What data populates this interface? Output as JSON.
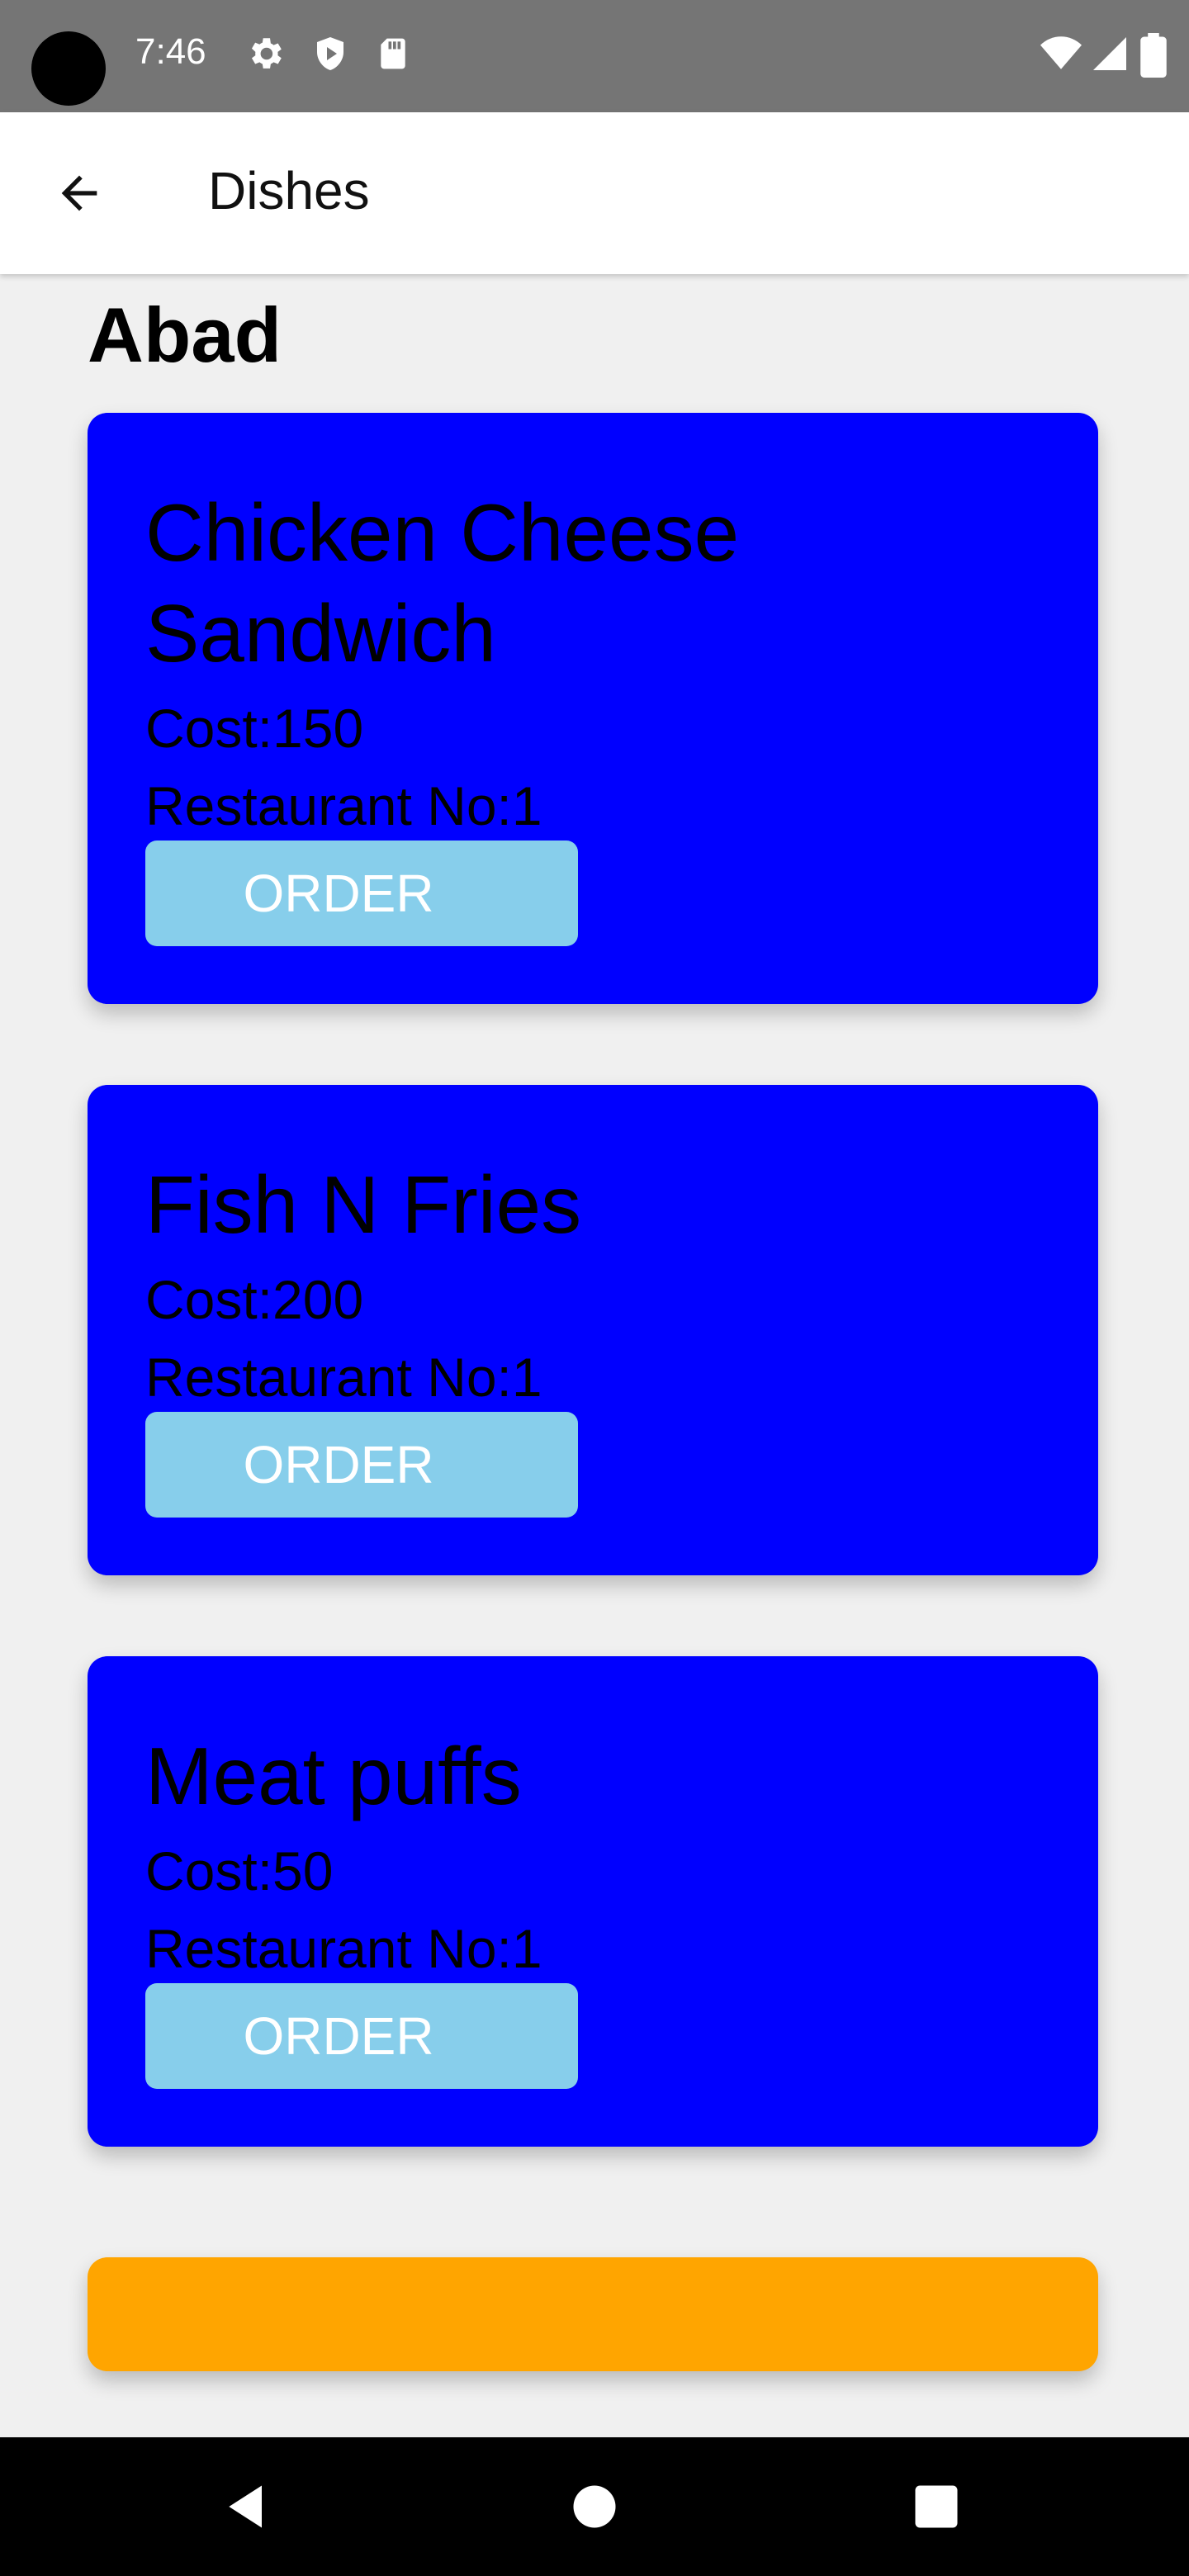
{
  "status_bar": {
    "time": "7:46",
    "icons": [
      "camera-dot",
      "settings-icon",
      "shield-icon",
      "sd-card-icon",
      "wifi-icon",
      "signal-icon",
      "battery-icon"
    ]
  },
  "app_bar": {
    "title": "Dishes",
    "back_icon": "arrow-left-icon"
  },
  "restaurant": {
    "name": "Abad"
  },
  "dishes": [
    {
      "name_line1": "Chicken Cheese",
      "name_line2": "Sandwich",
      "cost": "Cost:150",
      "restaurant": "Restaurant No:1",
      "button": "ORDER"
    },
    {
      "name_line1": "Fish N Fries",
      "cost": "Cost:200",
      "restaurant": "Restaurant No:1",
      "button": "ORDER"
    },
    {
      "name_line1": "Meat puffs",
      "cost": "Cost:50",
      "restaurant": "Restaurant No:1",
      "button": "ORDER"
    }
  ],
  "colors": {
    "card": "#0000ff",
    "order_button": "#87ceeb",
    "bottom_bar": "#ffa500"
  },
  "nav_bar": {
    "icons": [
      "back-triangle-icon",
      "home-circle-icon",
      "recents-square-icon"
    ]
  }
}
